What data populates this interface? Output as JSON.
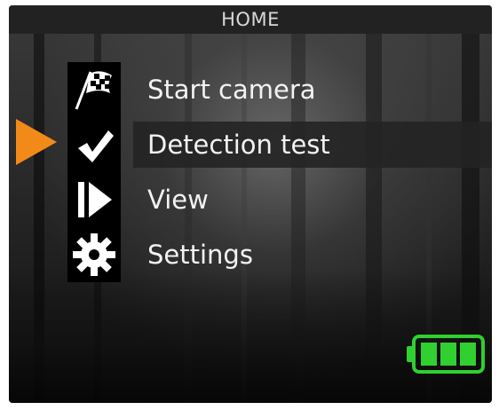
{
  "header": {
    "title": "HOME"
  },
  "menu": {
    "items": [
      {
        "label": "Start camera",
        "icon": "checkered-flag-icon"
      },
      {
        "label": "Detection test",
        "icon": "checkmark-icon",
        "selected": true
      },
      {
        "label": "View",
        "icon": "play-icon"
      },
      {
        "label": "Settings",
        "icon": "gear-icon"
      }
    ]
  },
  "colors": {
    "pointer": "#f28a1a",
    "battery": "#2fd02f",
    "title_bar": "#222222",
    "text": "#f2f2f2"
  },
  "battery": {
    "icon": "battery-icon",
    "level": 1.0
  }
}
